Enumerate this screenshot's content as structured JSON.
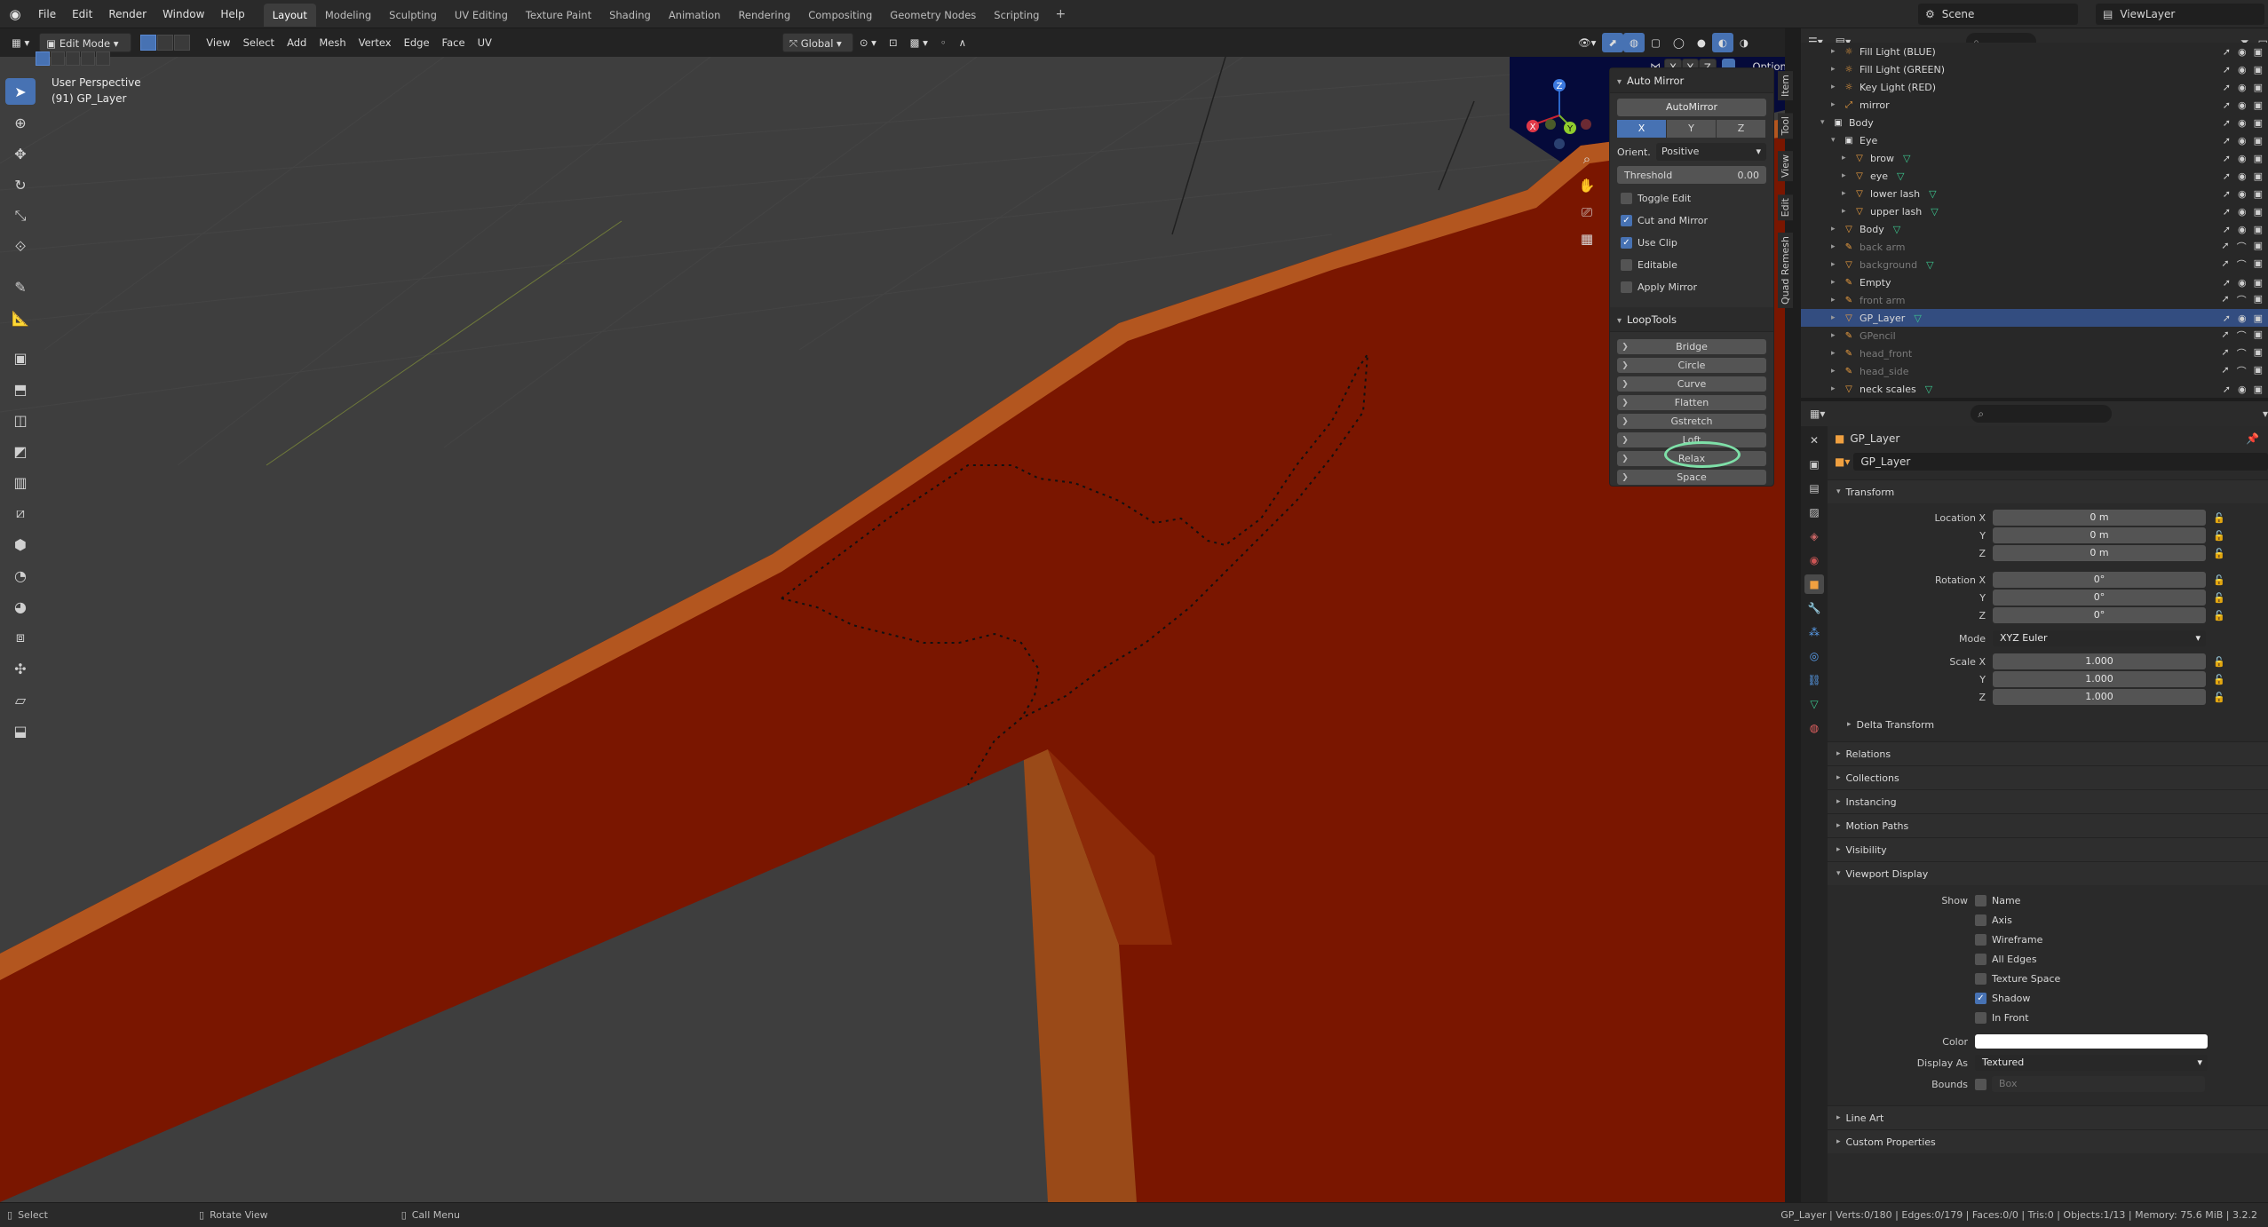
{
  "topbar": {
    "menus": [
      "File",
      "Edit",
      "Render",
      "Window",
      "Help"
    ],
    "workspaces": [
      "Layout",
      "Modeling",
      "Sculpting",
      "UV Editing",
      "Texture Paint",
      "Shading",
      "Animation",
      "Rendering",
      "Compositing",
      "Geometry Nodes",
      "Scripting"
    ],
    "active_workspace": "Layout",
    "scene": "Scene",
    "view_layer": "ViewLayer"
  },
  "viewport_header": {
    "mode": "Edit Mode",
    "menus": [
      "View",
      "Select",
      "Add",
      "Mesh",
      "Vertex",
      "Edge",
      "Face",
      "UV"
    ],
    "transform_orientation": "Global",
    "options_label": "Options",
    "axes": [
      "X",
      "Y",
      "Z"
    ]
  },
  "viewport": {
    "view_name": "User Perspective",
    "object_info": "(91) GP_Layer",
    "gizmo_axes": [
      "X",
      "Y",
      "Z"
    ]
  },
  "npanel": {
    "auto_mirror": {
      "title": "Auto Mirror",
      "button": "AutoMirror",
      "axes": [
        "X",
        "Y",
        "Z"
      ],
      "active_axis": "X",
      "orient_label": "Orient.",
      "orient_value": "Positive",
      "threshold_label": "Threshold",
      "threshold_value": "0.00",
      "checks": [
        {
          "label": "Toggle Edit",
          "checked": false
        },
        {
          "label": "Cut and Mirror",
          "checked": true
        },
        {
          "label": "Use Clip",
          "checked": true
        },
        {
          "label": "Editable",
          "checked": false
        },
        {
          "label": "Apply Mirror",
          "checked": false
        }
      ]
    },
    "looptools": {
      "title": "LoopTools",
      "buttons": [
        "Bridge",
        "Circle",
        "Curve",
        "Flatten",
        "Gstretch",
        "Loft",
        "Relax",
        "Space"
      ],
      "highlighted": "Relax"
    },
    "side_tabs": [
      "Item",
      "Tool",
      "View",
      "Edit",
      "Quad Remesh"
    ]
  },
  "outliner": {
    "rows": [
      {
        "name": "Fill Light (BLUE)",
        "indent": 2,
        "kind": "light",
        "dim": false,
        "sel": false
      },
      {
        "name": "Fill Light (GREEN)",
        "indent": 2,
        "kind": "light",
        "dim": false,
        "sel": false
      },
      {
        "name": "Key Light (RED)",
        "indent": 2,
        "kind": "light",
        "dim": false,
        "sel": false
      },
      {
        "name": "mirror",
        "indent": 2,
        "kind": "empty",
        "dim": false,
        "sel": false
      },
      {
        "name": "Body",
        "indent": 1,
        "kind": "collection",
        "dim": false,
        "sel": false
      },
      {
        "name": "Eye",
        "indent": 2,
        "kind": "collection",
        "dim": false,
        "sel": false
      },
      {
        "name": "brow",
        "indent": 3,
        "kind": "mesh",
        "dim": false,
        "sel": false
      },
      {
        "name": "eye",
        "indent": 3,
        "kind": "mesh",
        "dim": false,
        "sel": false
      },
      {
        "name": "lower lash",
        "indent": 3,
        "kind": "mesh",
        "dim": false,
        "sel": false
      },
      {
        "name": "upper lash",
        "indent": 3,
        "kind": "mesh",
        "dim": false,
        "sel": false
      },
      {
        "name": "Body",
        "indent": 2,
        "kind": "mesh",
        "dim": false,
        "sel": false
      },
      {
        "name": "back arm",
        "indent": 2,
        "kind": "gp",
        "dim": true,
        "sel": false
      },
      {
        "name": "background",
        "indent": 2,
        "kind": "mesh",
        "dim": true,
        "sel": false
      },
      {
        "name": "Empty",
        "indent": 2,
        "kind": "gp",
        "dim": false,
        "sel": false
      },
      {
        "name": "front arm",
        "indent": 2,
        "kind": "gp",
        "dim": true,
        "sel": false
      },
      {
        "name": "GP_Layer",
        "indent": 2,
        "kind": "mesh",
        "dim": false,
        "sel": true
      },
      {
        "name": "GPencil",
        "indent": 2,
        "kind": "gp",
        "dim": true,
        "sel": false
      },
      {
        "name": "head_front",
        "indent": 2,
        "kind": "gp",
        "dim": true,
        "sel": false
      },
      {
        "name": "head_side",
        "indent": 2,
        "kind": "gp",
        "dim": true,
        "sel": false
      },
      {
        "name": "neck scales",
        "indent": 2,
        "kind": "mesh",
        "dim": false,
        "sel": false
      }
    ]
  },
  "properties": {
    "object_name": "GP_Layer",
    "object_field": "GP_Layer",
    "transform_title": "Transform",
    "location_label": "Location X",
    "location": [
      "0 m",
      "0 m",
      "0 m"
    ],
    "rotation_label": "Rotation X",
    "rotation": [
      "0°",
      "0°",
      "0°"
    ],
    "mode_label": "Mode",
    "mode_value": "XYZ Euler",
    "scale_label": "Scale X",
    "scale": [
      "1.000",
      "1.000",
      "1.000"
    ],
    "y_label": "Y",
    "z_label": "Z",
    "delta_transform": "Delta Transform",
    "sections": [
      "Relations",
      "Collections",
      "Instancing",
      "Motion Paths",
      "Visibility"
    ],
    "viewport_display": {
      "title": "Viewport Display",
      "show_label": "Show",
      "checks": [
        {
          "label": "Name",
          "checked": false
        },
        {
          "label": "Axis",
          "checked": false
        },
        {
          "label": "Wireframe",
          "checked": false
        },
        {
          "label": "All Edges",
          "checked": false
        },
        {
          "label": "Texture Space",
          "checked": false
        },
        {
          "label": "Shadow",
          "checked": true
        },
        {
          "label": "In Front",
          "checked": false
        }
      ],
      "color_label": "Color",
      "display_as_label": "Display As",
      "display_as_value": "Textured",
      "bounds_label": "Bounds",
      "bounds_value": "Box"
    },
    "trailing_sections": [
      "Line Art",
      "Custom Properties"
    ]
  },
  "statusbar": {
    "select": "Select",
    "rotate": "Rotate View",
    "call_menu": "Call Menu",
    "stats": "GP_Layer | Verts:0/180 | Edges:0/179 | Faces:0/0 | Tris:0 | Objects:1/13 | Memory: 75.6 MiB | 3.2.2"
  },
  "colors": {
    "accent": "#4772b3",
    "mesh_red": "#7a1600",
    "mesh_orange": "#a0521c",
    "highlight_ring": "#7ee0a8"
  }
}
